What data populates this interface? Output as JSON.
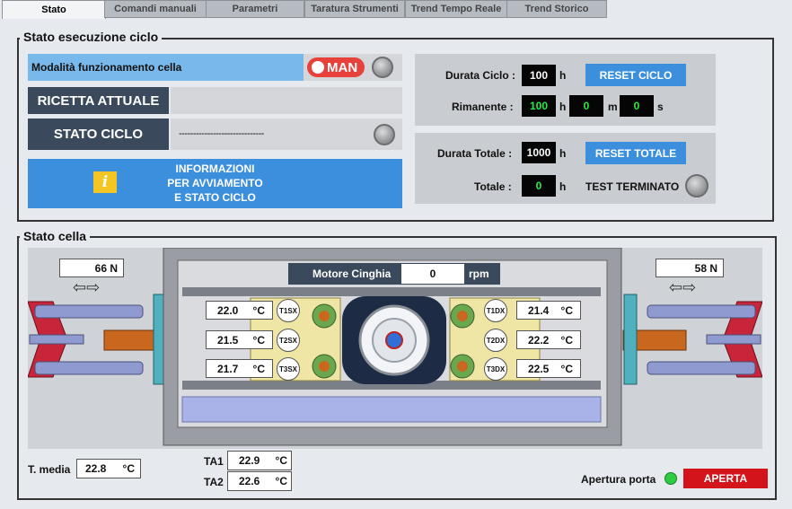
{
  "tabs": [
    {
      "label": "Stato",
      "active": true
    },
    {
      "label": "Comandi manuali",
      "active": false
    },
    {
      "label": "Parametri",
      "active": false
    },
    {
      "label": "Taratura Strumenti",
      "active": false
    },
    {
      "label": "Trend Tempo Reale",
      "active": false
    },
    {
      "label": "Trend Storico",
      "active": false
    }
  ],
  "cycle_section": {
    "title": "Stato esecuzione ciclo",
    "mode_label": "Modalità funzionamento cella",
    "mode_toggle": "MAN",
    "recipe_label": "RICETTA ATTUALE",
    "recipe_value": "",
    "cycle_state_label": "STATO CICLO",
    "cycle_state_value": "------------------------------",
    "info_line1": "INFORMAZIONI",
    "info_line2": "PER AVVIAMENTO",
    "info_line3": "E STATO CICLO",
    "info_icon": "i",
    "durata_ciclo_label": "Durata Ciclo :",
    "durata_ciclo_value": "100",
    "unit_h": "h",
    "unit_m": "m",
    "unit_s": "s",
    "reset_ciclo": "RESET CICLO",
    "rimanente_label": "Rimanente :",
    "rimanente_h": "100",
    "rimanente_m": "0",
    "rimanente_s": "0",
    "durata_totale_label": "Durata Totale :",
    "durata_totale_value": "1000",
    "reset_totale": "RESET TOTALE",
    "totale_label": "Totale :",
    "totale_value": "0",
    "test_terminato": "TEST TERMINATO"
  },
  "cell_section": {
    "title": "Stato cella",
    "force_left": "66 N",
    "force_right": "58 N",
    "motor_label": "Motore Cinghia",
    "motor_value": "0",
    "motor_unit": "rpm",
    "unit_c": "°C",
    "temps_left": [
      {
        "value": "22.0",
        "sensor": "T1SX"
      },
      {
        "value": "21.5",
        "sensor": "T2SX"
      },
      {
        "value": "21.7",
        "sensor": "T3SX"
      }
    ],
    "temps_right": [
      {
        "value": "21.4",
        "sensor": "T1DX"
      },
      {
        "value": "22.2",
        "sensor": "T2DX"
      },
      {
        "value": "22.5",
        "sensor": "T3DX"
      }
    ],
    "t_media_label": "T. media",
    "t_media_value": "22.8",
    "ta1_label": "TA1",
    "ta1_value": "22.9",
    "ta2_label": "TA2",
    "ta2_value": "22.6",
    "door_label": "Apertura porta",
    "door_state": "APERTA"
  },
  "colors": {
    "accent_blue": "#3c8fdd",
    "lamp_green": "#2ecc40",
    "alarm_red": "#d3141a",
    "toggle_red": "#e8413c",
    "digit_green": "#22ee44"
  },
  "icons": [
    "info-icon",
    "double-arrow-icon",
    "motor-wheel-icon"
  ]
}
